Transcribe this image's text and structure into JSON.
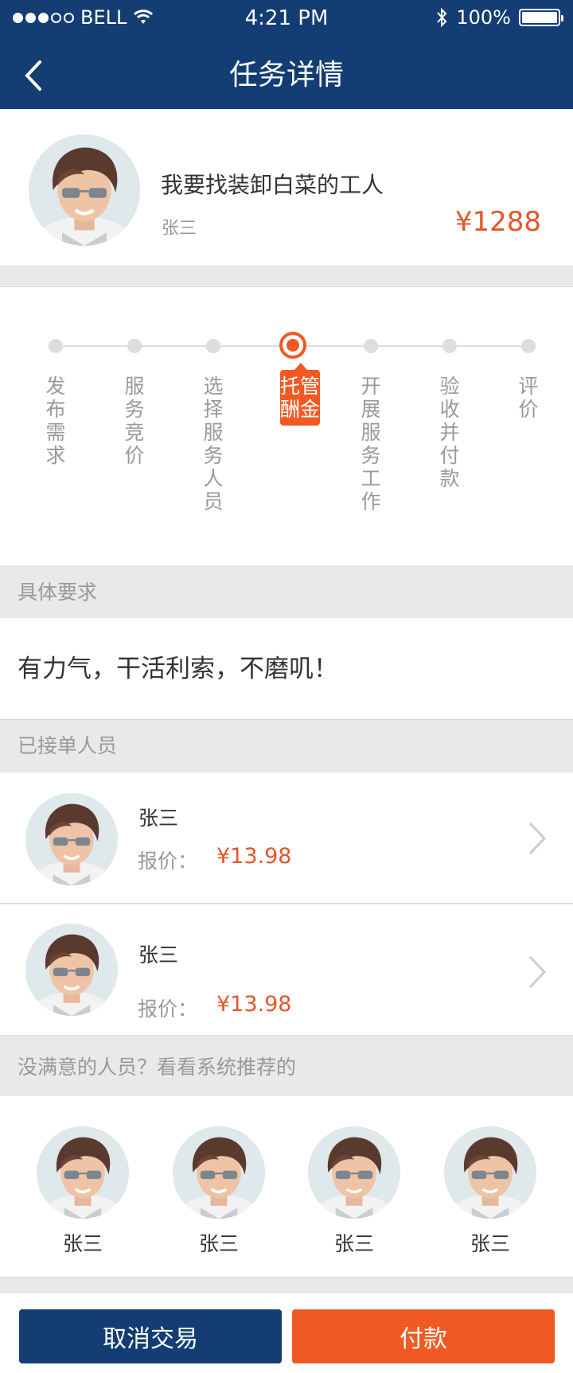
{
  "status_bar": {
    "carrier": "BELL",
    "time": "4:21 PM",
    "battery": "100%"
  },
  "nav": {
    "title": "任务详情",
    "back_icon": "chevron-left-icon"
  },
  "task": {
    "title": "我要找装卸白菜的工人",
    "owner": "张三",
    "price": "¥1288"
  },
  "progress": {
    "active_index": 3,
    "steps": [
      {
        "label": "发布需求"
      },
      {
        "label": "服务竞价"
      },
      {
        "label": "选择服务人员"
      },
      {
        "label": "托管酬金"
      },
      {
        "label": "开展服务工作"
      },
      {
        "label": "验收并付款"
      },
      {
        "label": "评价"
      }
    ]
  },
  "requirements": {
    "header": "具体要求",
    "text": "有力气，干活利索，不磨叽！"
  },
  "accepted": {
    "header": "已接单人员",
    "workers": [
      {
        "name": "张三",
        "quote_label": "报价：",
        "quote_value": "¥13.98"
      },
      {
        "name": "张三",
        "quote_label": "报价：",
        "quote_value": "¥13.98"
      }
    ]
  },
  "recommend": {
    "header": "没满意的人员？看看系统推荐的",
    "people": [
      {
        "name": "张三"
      },
      {
        "name": "张三"
      },
      {
        "name": "张三"
      },
      {
        "name": "张三"
      }
    ]
  },
  "actions": {
    "cancel_label": "取消交易",
    "pay_label": "付款"
  },
  "colors": {
    "brand": "#133d73",
    "accent": "#f05a22",
    "price": "#e2572a"
  }
}
